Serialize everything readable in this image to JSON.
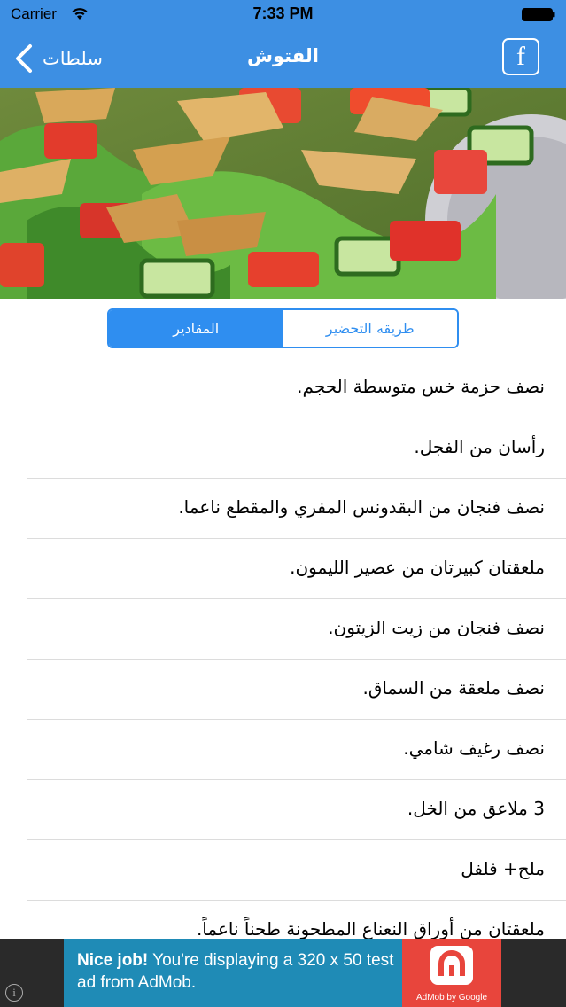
{
  "status_bar": {
    "carrier": "Carrier",
    "time": "7:33 PM"
  },
  "nav": {
    "back_label": "سلطات",
    "title": "الفتوش",
    "facebook_glyph": "f"
  },
  "segments": {
    "active_label": "المقادير",
    "inactive_label": "طريقه التحضير"
  },
  "ingredients": [
    "نصف حزمة خس متوسطة الحجم.",
    "رأسان من الفجل.",
    "نصف فنجان من البقدونس المفري والمقطع ناعما.",
    "ملعقتان كبيرتان من عصير الليمون.",
    "نصف فنجان من زيت الزيتون.",
    "نصف ملعقة من السماق.",
    "نصف رغيف شامي.",
    "3 ملاعق من الخل.",
    "ملح+ فلفل",
    "ملعقتان من أوراق النعناع المطحونة طحناً ناعماً."
  ],
  "ad": {
    "headline": "Nice job!",
    "body": "You're displaying a 320 x 50 test ad from AdMob.",
    "logo_label": "AdMob by Google",
    "info_glyph": "i"
  },
  "colors": {
    "nav": "#3d8fe3",
    "segment": "#2f8ef0",
    "ad_banner": "#1f8bb6",
    "ad_logo": "#e8453c"
  }
}
